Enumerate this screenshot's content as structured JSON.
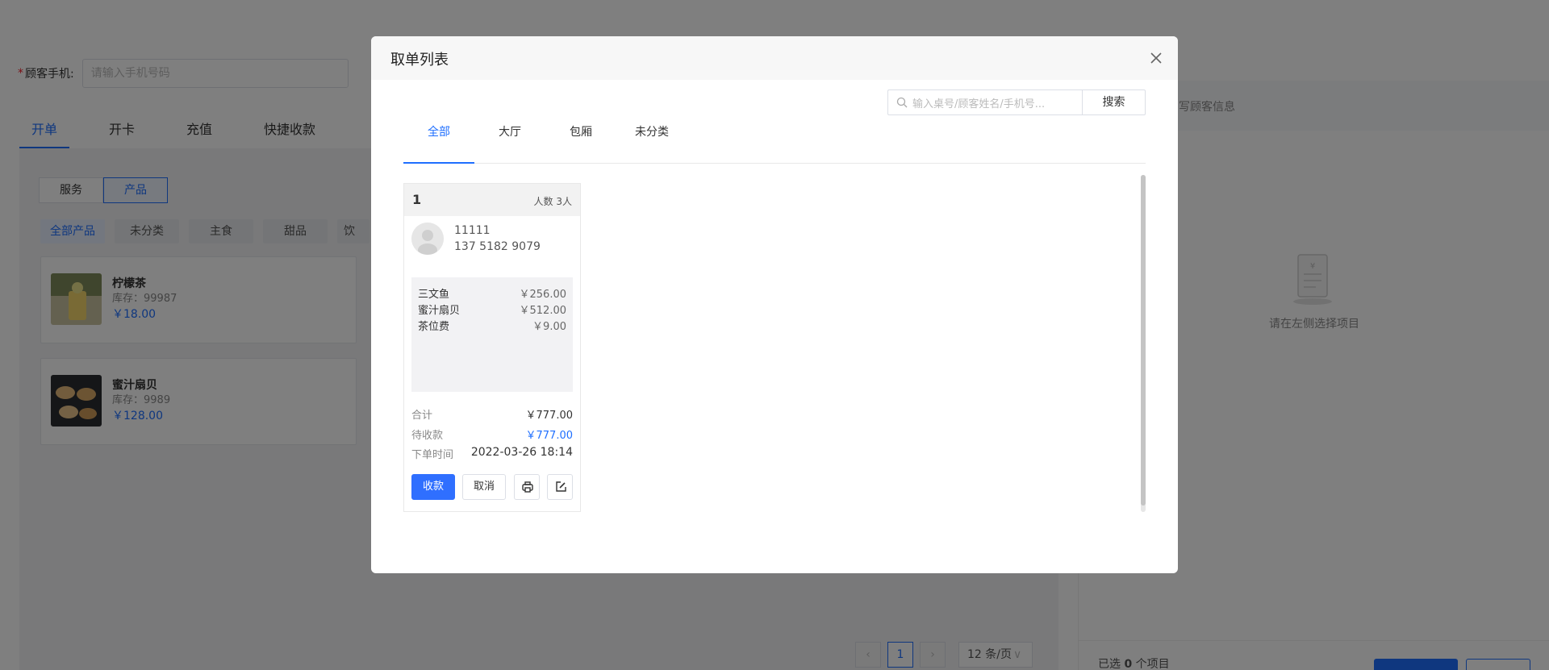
{
  "background": {
    "phone_label": "顾客手机:",
    "phone_placeholder": "请输入手机号码",
    "main_tabs": [
      "开单",
      "开卡",
      "充值",
      "快捷收款"
    ],
    "type_switch": [
      "服务",
      "产品"
    ],
    "categories": [
      "全部产品",
      "未分类",
      "主食",
      "甜品",
      "饮"
    ],
    "products": [
      {
        "name": "柠檬茶",
        "stock": "库存：99987",
        "price": "￥18.00"
      },
      {
        "name": "蜜汁扇贝",
        "stock": "库存：9989",
        "price": "￥128.00"
      }
    ],
    "pagination": {
      "current": "1",
      "page_size": "12 条/页"
    },
    "right_panel": {
      "header_hint": "写顾客信息",
      "empty_text": "请在左侧选择项目",
      "footer_prefix": "已选",
      "footer_count": "0",
      "footer_suffix": "个项目"
    }
  },
  "modal": {
    "title": "取单列表",
    "tabs": [
      "全部",
      "大厅",
      "包厢",
      "未分类"
    ],
    "active_tab": "全部",
    "search": {
      "placeholder": "输入桌号/顾客姓名/手机号...",
      "button": "搜索"
    },
    "orders": [
      {
        "table": "1",
        "guests": "人数 3人",
        "customer_name": "11111",
        "customer_phone": "137 5182 9079",
        "items": [
          {
            "name": "三文鱼",
            "price": "￥256.00"
          },
          {
            "name": "蜜汁扇贝",
            "price": "￥512.00"
          },
          {
            "name": "茶位费",
            "price": "￥9.00"
          }
        ],
        "total_label": "合计",
        "total": "￥777.00",
        "due_label": "待收款",
        "due": "￥777.00",
        "time_label": "下单时间",
        "time": "2022-03-26 18:14",
        "buttons": {
          "pay": "收款",
          "cancel": "取消"
        }
      }
    ]
  },
  "colors": {
    "primary": "#1f6fff",
    "mask": "rgba(0,0,0,0.5)"
  },
  "icons": [
    "close-icon",
    "search-icon",
    "avatar-icon",
    "print-icon",
    "edit-icon",
    "empty-receipt-icon"
  ]
}
